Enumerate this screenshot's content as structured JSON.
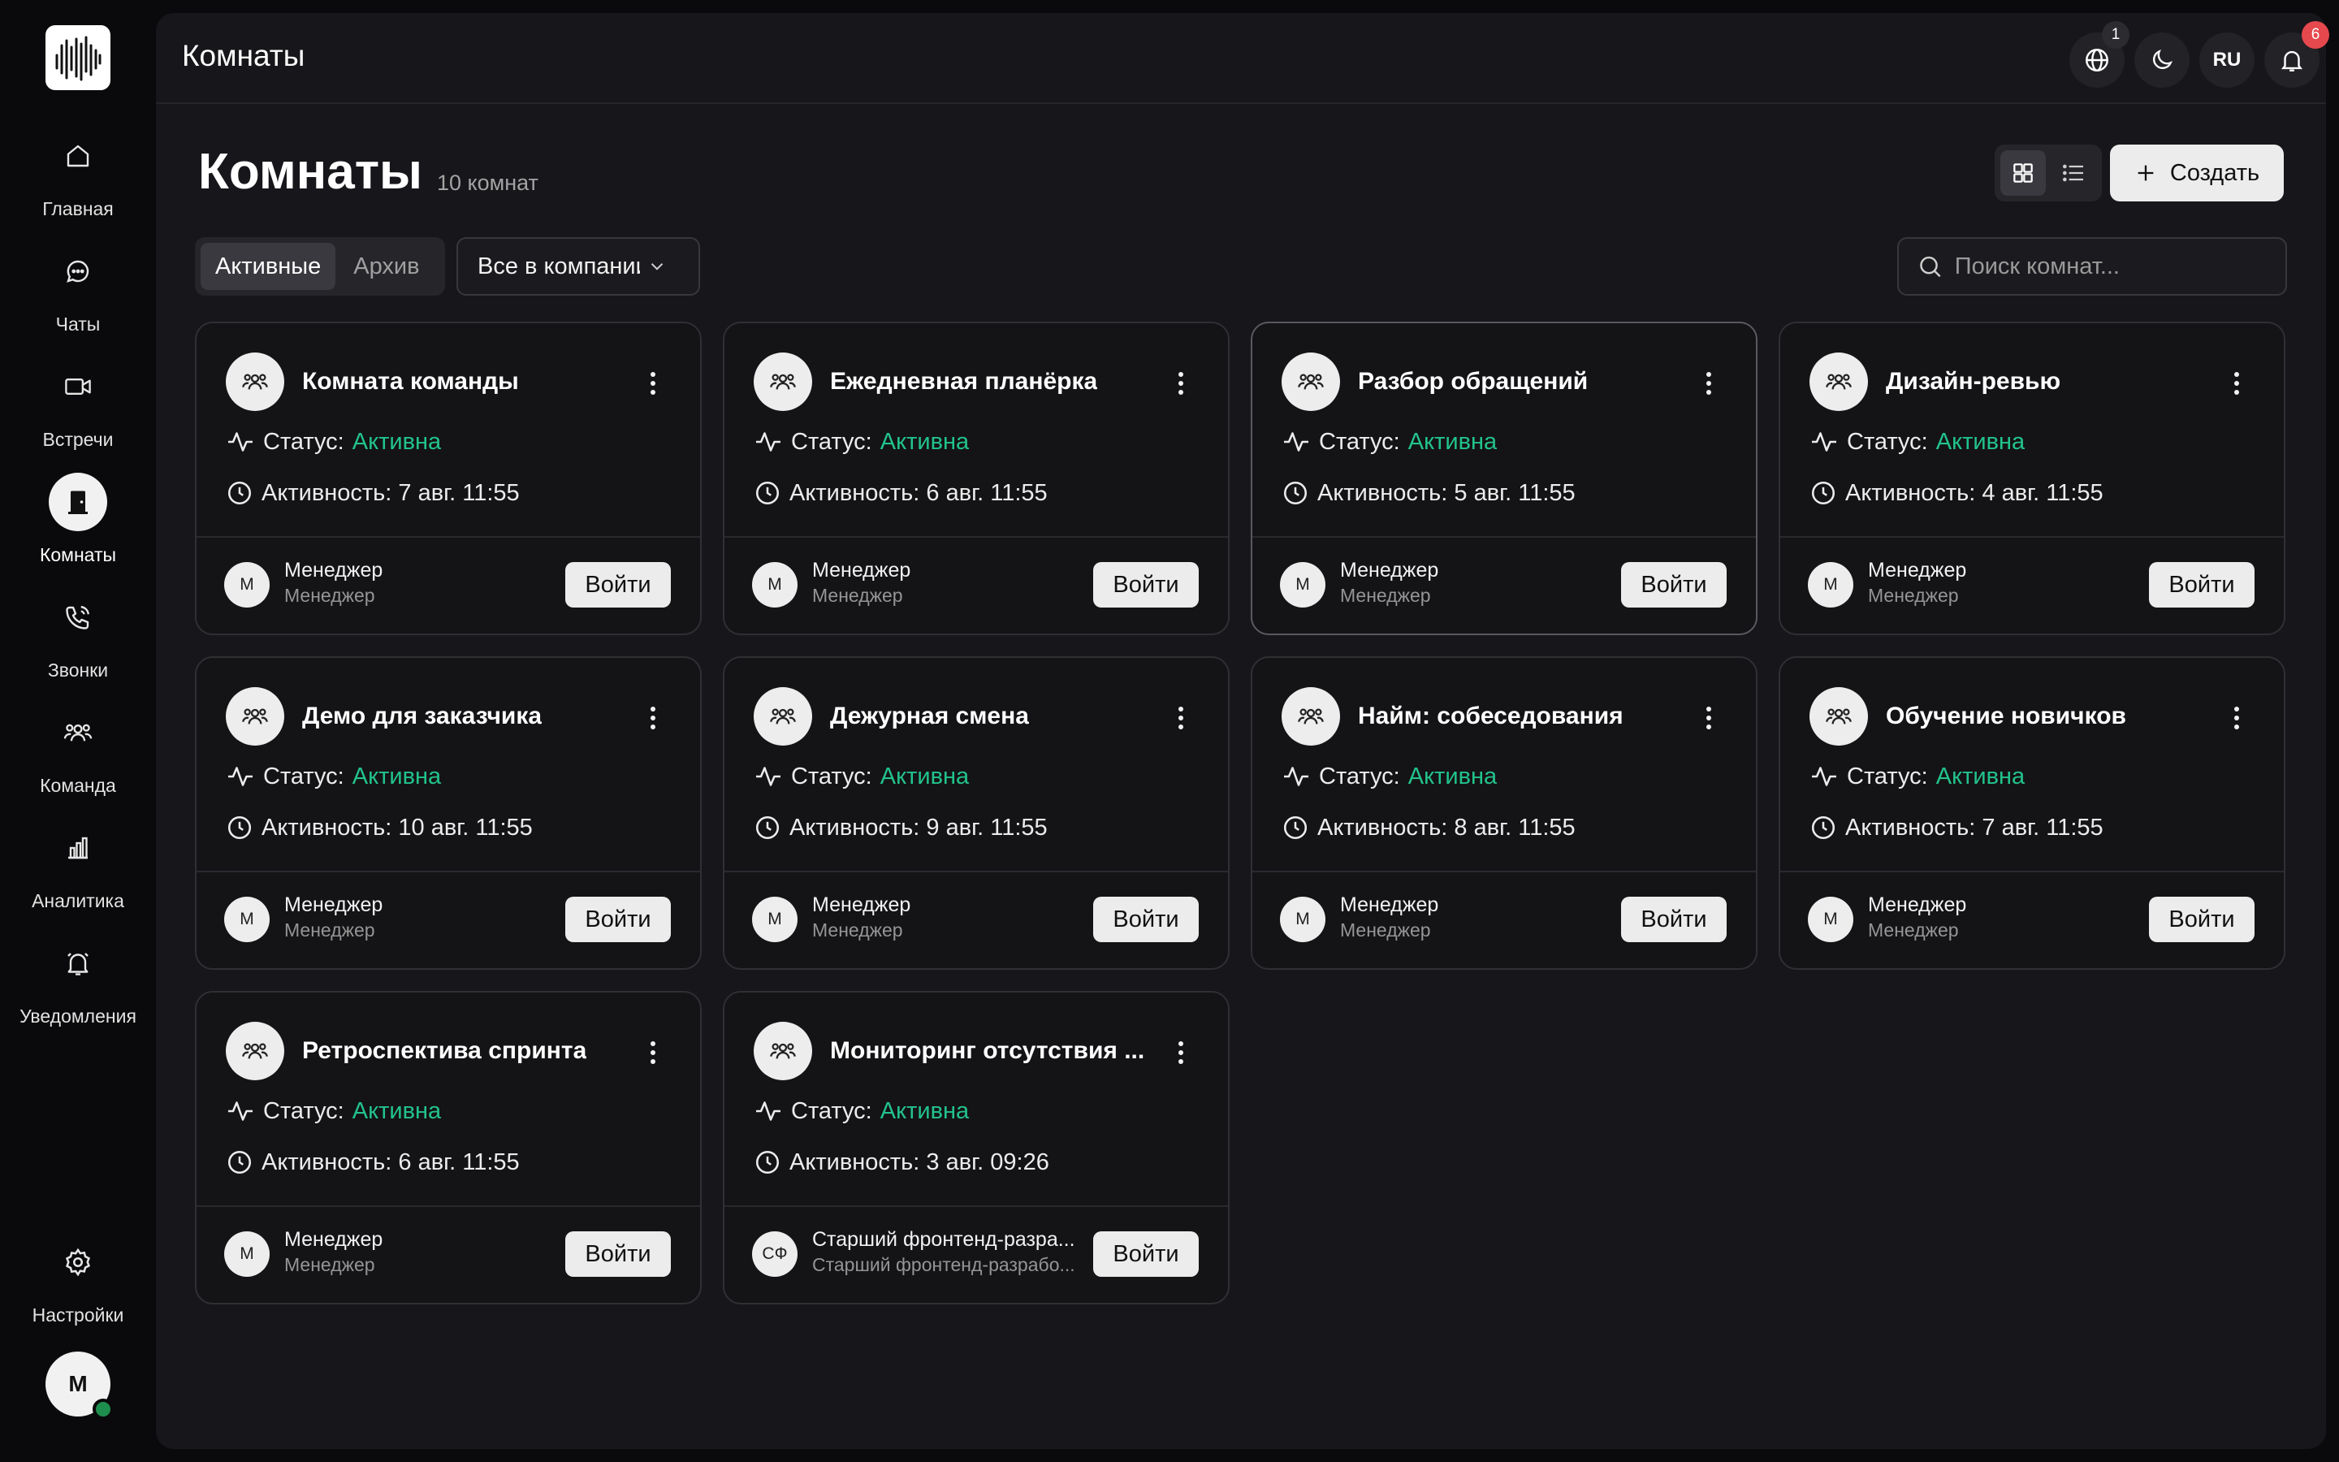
{
  "sidebar": {
    "items": [
      {
        "label": "Главная",
        "icon": "home-icon"
      },
      {
        "label": "Чаты",
        "icon": "chat-icon"
      },
      {
        "label": "Встречи",
        "icon": "video-icon"
      },
      {
        "label": "Комнаты",
        "icon": "door-icon",
        "active": true
      },
      {
        "label": "Звонки",
        "icon": "phone-icon"
      },
      {
        "label": "Команда",
        "icon": "team-icon"
      },
      {
        "label": "Аналитика",
        "icon": "chart-icon"
      },
      {
        "label": "Уведомления",
        "icon": "bell-icon"
      }
    ],
    "settings_label": "Настройки",
    "user_initial": "M"
  },
  "topbar": {
    "title": "Комнаты",
    "globe_badge": "1",
    "lang": "RU",
    "notif_badge": "6"
  },
  "page": {
    "title": "Комнаты",
    "count": "10 комнат",
    "create_label": "Создать",
    "tabs": [
      "Активные",
      "Архив"
    ],
    "filter": "Все в компании",
    "search_placeholder": "Поиск комнат..."
  },
  "colors": {
    "accent_status": "#22c38b",
    "badge_red": "#e5484d",
    "online": "#1e8e4e"
  },
  "rooms": [
    {
      "title": "Комната команды",
      "status_label": "Статус:",
      "status": "Активна",
      "activity": "Активность: 7 авг. 11:55",
      "owner_initial": "М",
      "owner_name": "Менеджер",
      "owner_role": "Менеджер",
      "enter": "Войти"
    },
    {
      "title": "Ежедневная планёрка",
      "status_label": "Статус:",
      "status": "Активна",
      "activity": "Активность: 6 авг. 11:55",
      "owner_initial": "М",
      "owner_name": "Менеджер",
      "owner_role": "Менеджер",
      "enter": "Войти"
    },
    {
      "title": "Разбор обращений",
      "status_label": "Статус:",
      "status": "Активна",
      "activity": "Активность: 5 авг. 11:55",
      "owner_initial": "М",
      "owner_name": "Менеджер",
      "owner_role": "Менеджер",
      "enter": "Войти",
      "highlight": true
    },
    {
      "title": "Дизайн-ревью",
      "status_label": "Статус:",
      "status": "Активна",
      "activity": "Активность: 4 авг. 11:55",
      "owner_initial": "М",
      "owner_name": "Менеджер",
      "owner_role": "Менеджер",
      "enter": "Войти"
    },
    {
      "title": "Демо для заказчика",
      "status_label": "Статус:",
      "status": "Активна",
      "activity": "Активность: 10 авг. 11:55",
      "owner_initial": "М",
      "owner_name": "Менеджер",
      "owner_role": "Менеджер",
      "enter": "Войти"
    },
    {
      "title": "Дежурная смена",
      "status_label": "Статус:",
      "status": "Активна",
      "activity": "Активность: 9 авг. 11:55",
      "owner_initial": "М",
      "owner_name": "Менеджер",
      "owner_role": "Менеджер",
      "enter": "Войти"
    },
    {
      "title": "Найм: собеседования",
      "status_label": "Статус:",
      "status": "Активна",
      "activity": "Активность: 8 авг. 11:55",
      "owner_initial": "М",
      "owner_name": "Менеджер",
      "owner_role": "Менеджер",
      "enter": "Войти"
    },
    {
      "title": "Обучение новичков",
      "status_label": "Статус:",
      "status": "Активна",
      "activity": "Активность: 7 авг. 11:55",
      "owner_initial": "М",
      "owner_name": "Менеджер",
      "owner_role": "Менеджер",
      "enter": "Войти"
    },
    {
      "title": "Ретроспектива спринта",
      "status_label": "Статус:",
      "status": "Активна",
      "activity": "Активность: 6 авг. 11:55",
      "owner_initial": "М",
      "owner_name": "Менеджер",
      "owner_role": "Менеджер",
      "enter": "Войти"
    },
    {
      "title": "Мониторинг отсутствия ...",
      "status_label": "Статус:",
      "status": "Активна",
      "activity": "Активность: 3 авг. 09:26",
      "owner_initial": "СФ",
      "owner_name": "Старший фронтенд-разра...",
      "owner_role": "Старший фронтенд-разрабо...",
      "enter": "Войти"
    }
  ]
}
